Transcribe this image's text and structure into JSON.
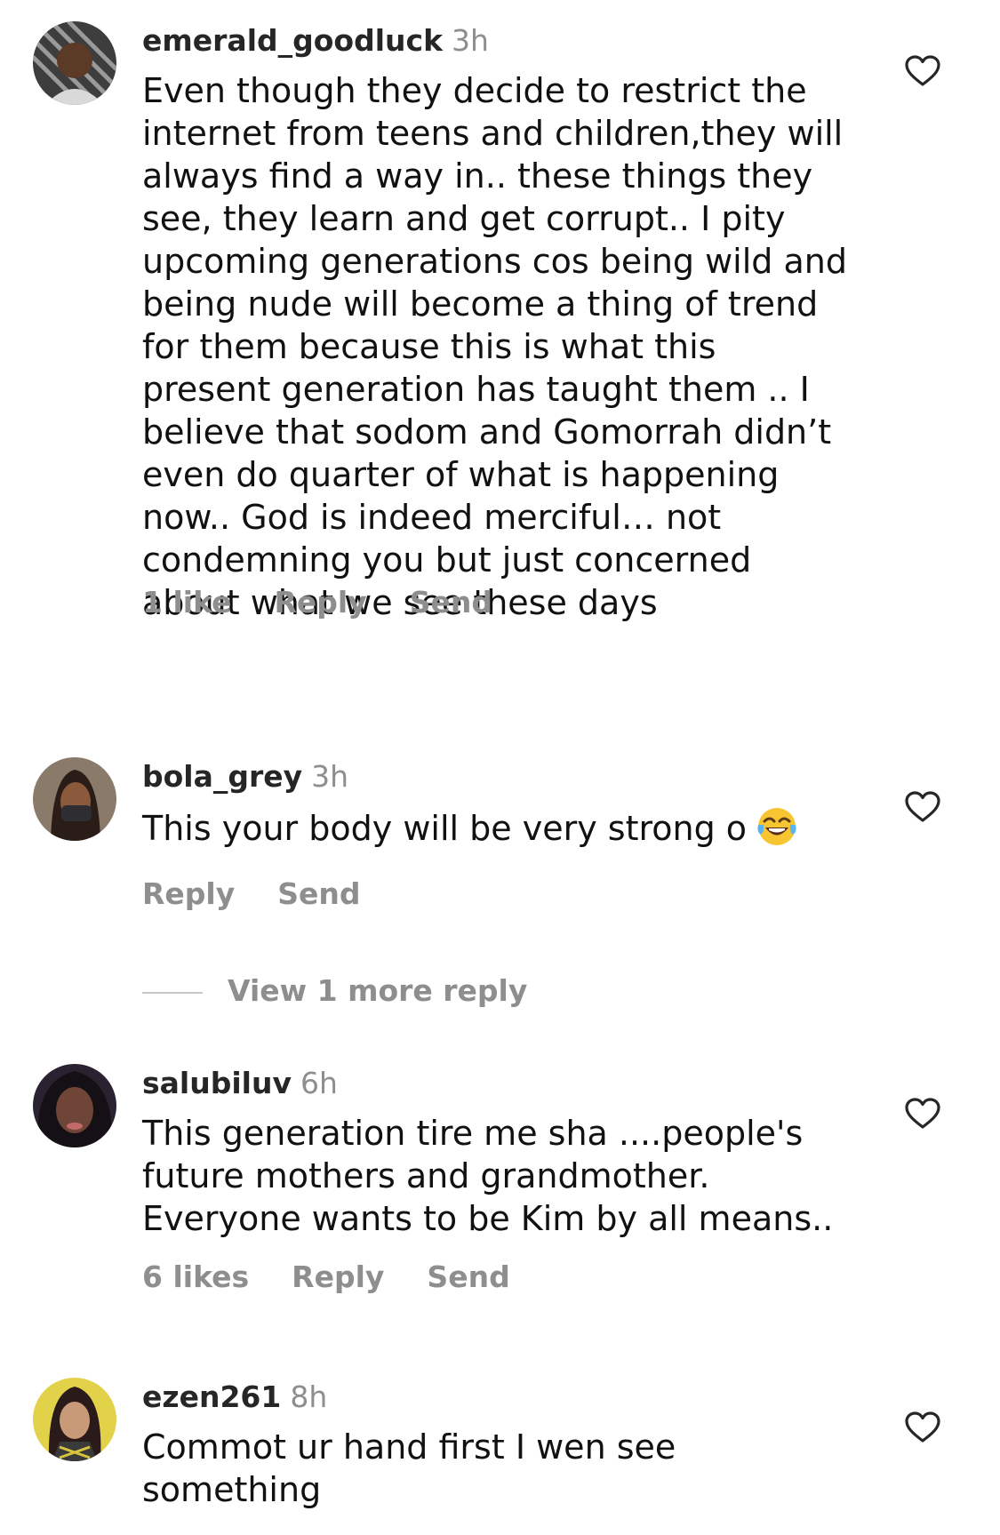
{
  "comments": [
    {
      "username": "emerald_goodluck",
      "time": "3h",
      "text": "Even though they decide to restrict the internet from teens and children,they will always find a way in.. these things they see, they learn and get corrupt.. I pity upcoming generations cos being wild and being nude will become a thing of trend for them because this is what this present generation has taught them .. I believe that sodom and Gomorrah didn’t even do quarter of what is happening now.. God is indeed merciful… not condemning you but just concerned about what we see these days",
      "likes": "1 like",
      "reply": "Reply",
      "send": "Send",
      "avatar_icon": "profile-photo-icon"
    },
    {
      "username": "bola_grey",
      "time": "3h",
      "text": "This your body will be very strong o",
      "emoji": "😂",
      "reply": "Reply",
      "send": "Send",
      "view_more": "View 1 more reply",
      "avatar_icon": "profile-photo-icon"
    },
    {
      "username": "salubiluv",
      "time": "6h",
      "text": "This generation tire me sha ....people's future mothers and grandmother. Everyone wants to be Kim by all means..",
      "likes": "6 likes",
      "reply": "Reply",
      "send": "Send",
      "avatar_icon": "profile-photo-icon"
    },
    {
      "username": "ezen261",
      "time": "8h",
      "text": "Commot ur hand first I wen see something",
      "avatar_icon": "profile-photo-icon"
    }
  ],
  "icons": {
    "like": "heart-outline-icon"
  },
  "colors": {
    "text": "#111111",
    "muted": "#8e8e8e",
    "background": "#ffffff"
  }
}
